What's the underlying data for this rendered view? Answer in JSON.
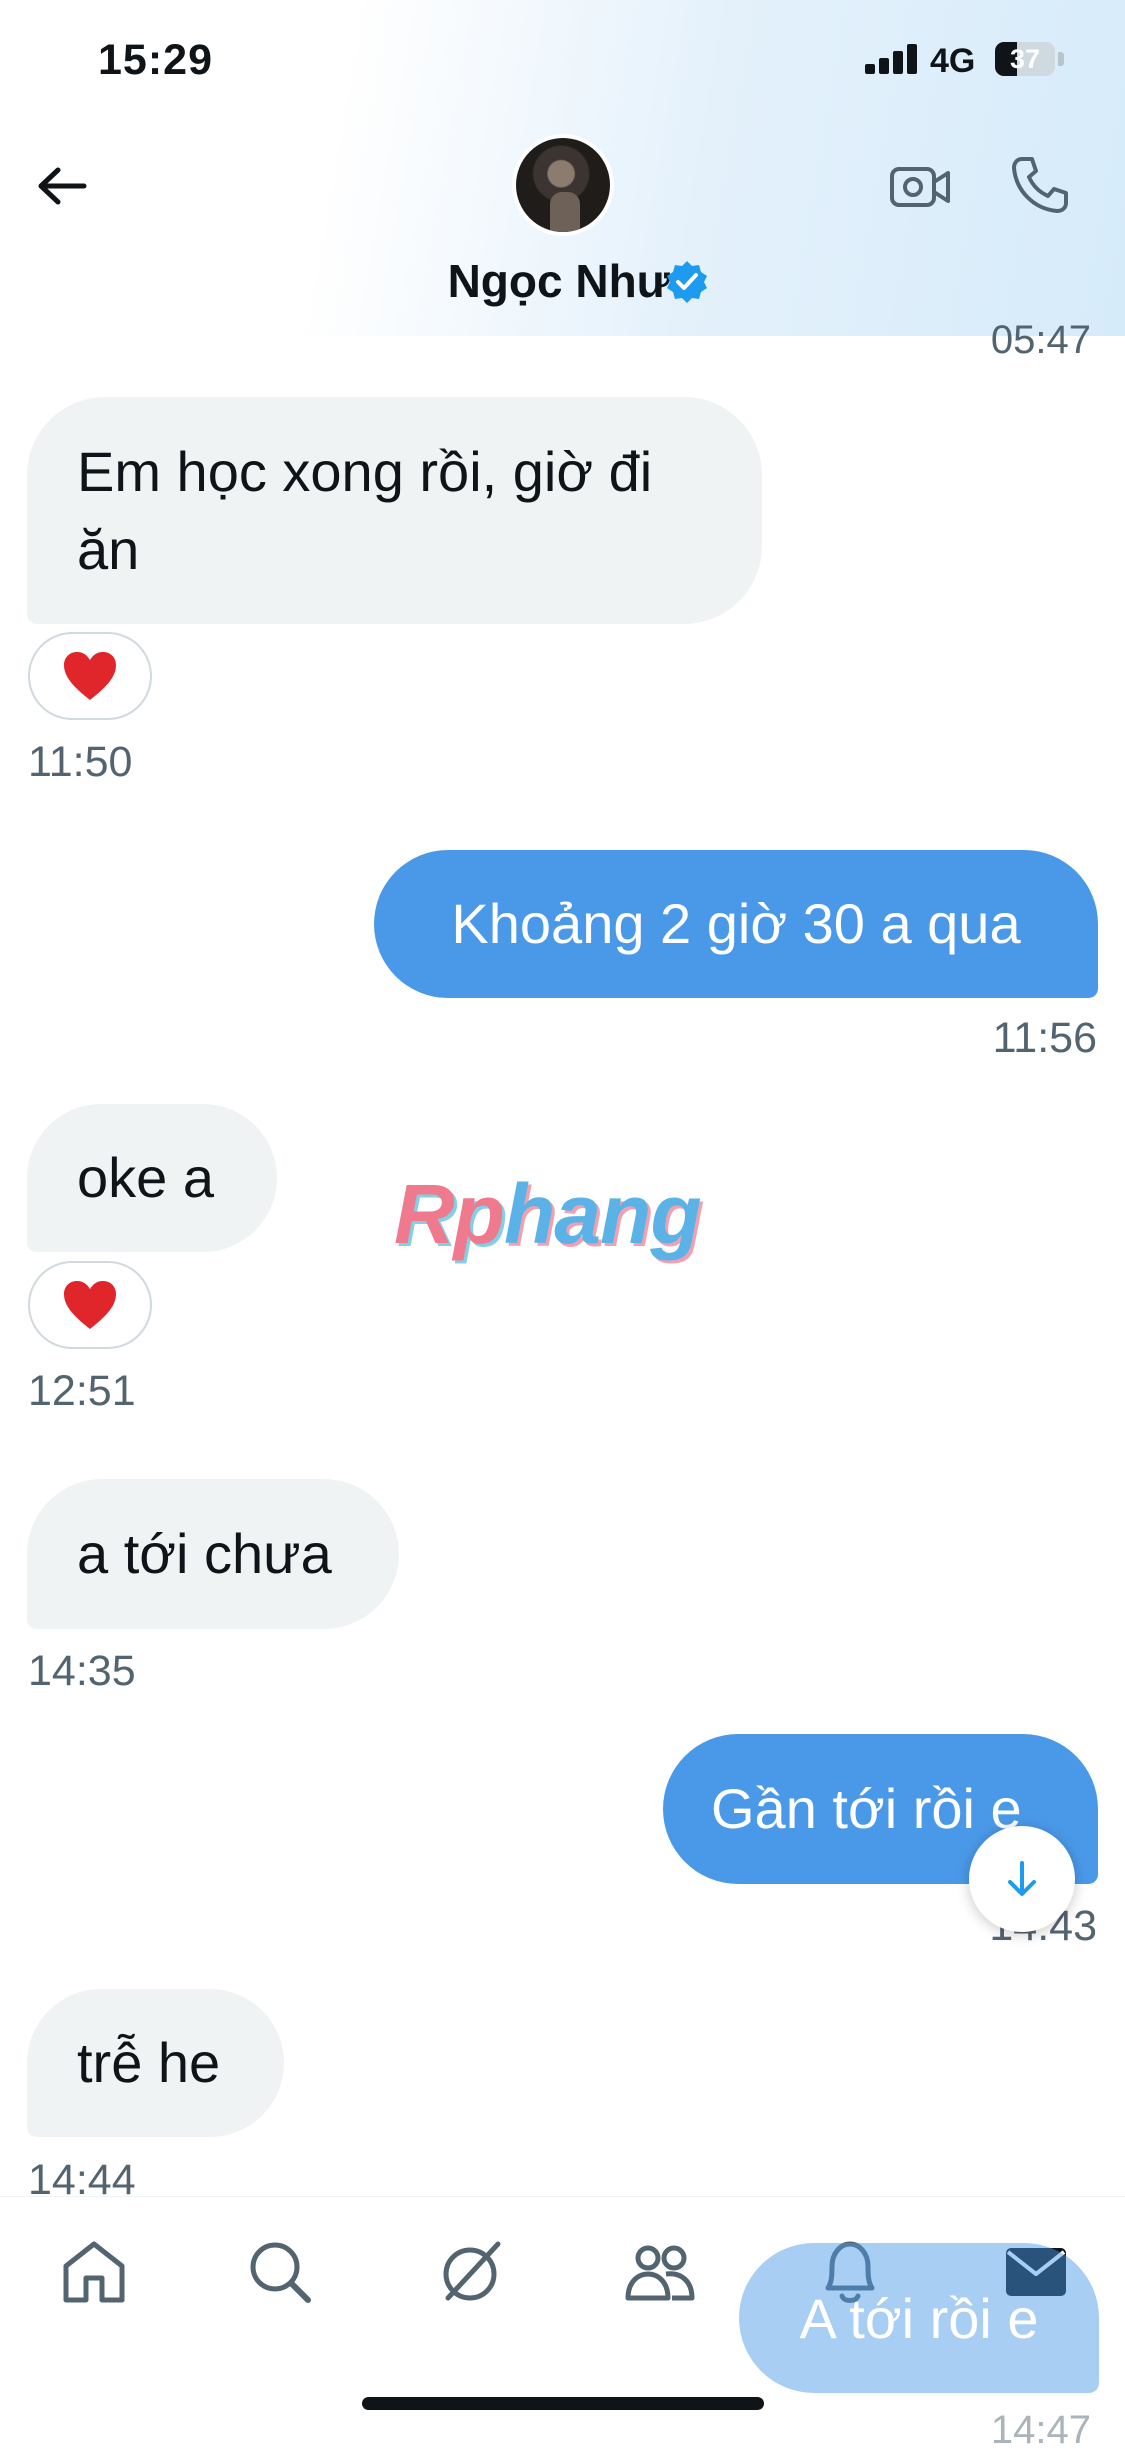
{
  "status_bar": {
    "time": "15:29",
    "network": "4G",
    "battery": "37",
    "battery_level_percent": 37
  },
  "header": {
    "contact_name": "Ngọc Như",
    "icons": {
      "back": "arrow-left-icon",
      "verified": "verified-badge-icon",
      "video": "video-camera-icon",
      "call": "phone-icon"
    }
  },
  "top_cut_time": "05:47",
  "messages": [
    {
      "direction": "in",
      "text_line1": "Em học xong rồi, giờ đi",
      "text_line2": "ăn",
      "reaction": "❤️",
      "time": "11:50"
    },
    {
      "direction": "out",
      "text": "Khoảng 2 giờ 30 a qua",
      "time": "11:56"
    },
    {
      "direction": "in",
      "text": "oke a",
      "reaction": "❤️",
      "time": "12:51"
    },
    {
      "direction": "in",
      "text": "a tới chưa",
      "time": "14:35"
    },
    {
      "direction": "out",
      "text": "Gần tới rồi e",
      "time": "14:43"
    },
    {
      "direction": "in",
      "text": "trễ he",
      "time": "14:44"
    }
  ],
  "watermark": {
    "part1": "Rp",
    "part2": "hang"
  },
  "scroll_down_icon": "arrow-down-icon",
  "draft_message": {
    "text": "A tới rồi e",
    "time": "14:47"
  },
  "bottom_nav": [
    "home-icon",
    "search-icon",
    "grok-icon",
    "communities-icon",
    "notifications-icon",
    "messages-icon"
  ],
  "colors": {
    "accent": "#4a99e9",
    "incoming_bubble": "#eff3f4",
    "verified": "#1d9bf0"
  }
}
